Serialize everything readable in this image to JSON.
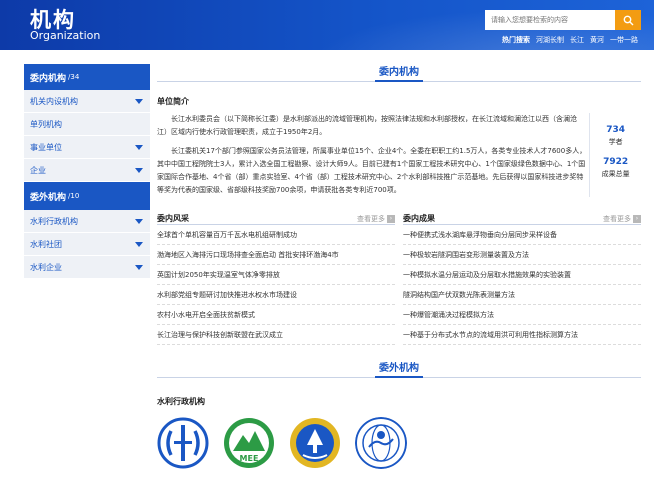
{
  "header": {
    "title_cn": "机构",
    "title_en": "Organization",
    "search_placeholder": "请输入您想要检索的内容",
    "hot_links": [
      "热门搜索",
      "河湖长制",
      "长江",
      "黄河",
      "一带一路"
    ]
  },
  "sidebar": {
    "group1": {
      "title": "委内机构",
      "count": "/34",
      "items": [
        "机关内设机构",
        "单列机构",
        "事业单位",
        "企业"
      ]
    },
    "group2": {
      "title": "委外机构",
      "count": "/10",
      "items": [
        "水利行政机构",
        "水利社团",
        "水利企业"
      ]
    }
  },
  "main": {
    "section1_title": "委内机构",
    "intro_heading": "单位简介",
    "intro_p1": "长江水利委员会（以下简称长江委）是水利部派出的流域管理机构，按照法律法规和水利部授权，在长江流域和澜沧江以西（含澜沧江）区域内行使水行政管理职责，成立于1950年2月。",
    "intro_p2": "长江委机关17个部门参照国家公务员法管理，所属事业单位15个、企业4个。全委在职职工约1.5万人，各类专业技术人才7600多人，其中中国工程院院士3人，累计入选全国工程勘察、设计大师9人。目前已建有1个国家工程技术研究中心、1个国家级绿色数据中心、1个国家国际合作基地、4个省（部）重点实验室、4个省（部）工程技术研究中心、2个水利部科技推广示范基地。先后获得以国家科技进步奖特等奖为代表的国家级、省部级科技奖励700余项，申请获批各类专利近700项。",
    "stats": [
      {
        "num": "734",
        "label": "学者"
      },
      {
        "num": "7922",
        "label": "成果总量"
      }
    ],
    "news_left": {
      "title": "委内风采",
      "more": "查看更多",
      "items": [
        "全球首个单机容量百万千瓦水电机组研制成功",
        "渤海地区入海排污口现场排查全面启动 首批安排环渤海4市",
        "英国计划2050年实现温室气体净零排放",
        "水利部党组专题研讨加快推进水权水市场建设",
        "农村小水电开启全面扶贫新模式",
        "长江治理与保护科技创新联盟在武汉成立"
      ]
    },
    "news_right": {
      "title": "委内成果",
      "more": "查看更多",
      "items": [
        "一种便携式浅水湖库悬浮物垂向分层同步采样设备",
        "一种极软岩隧洞围岩变形测量装置及方法",
        "一种模拟水温分层运动及分层取水措施效果的实验装置",
        "隧洞结构国产伏双数光陈表测量方法",
        "一种爆管潮涌决过程模拟方法",
        "一种基于分布式水节点的流域用洪可利用性指标测算方法"
      ]
    },
    "section2_title": "委外机构",
    "admin_heading": "水利行政机构",
    "logos": [
      "water-ministry-logo",
      "mee-logo",
      "forestry-logo",
      "meteorology-logo"
    ],
    "mee_text": "MEE"
  },
  "colors": {
    "primary": "#1a57c4",
    "header": "#0d3aa8",
    "search_btn": "#f39c12"
  }
}
